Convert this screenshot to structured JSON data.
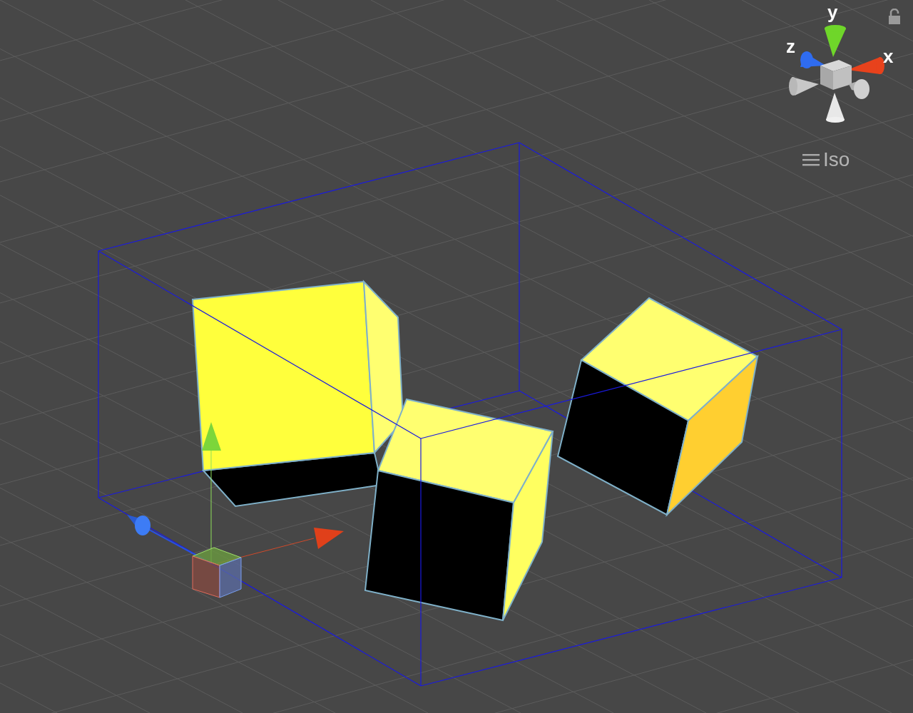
{
  "scene_gizmo": {
    "axes": [
      {
        "label": "y",
        "color": "#6fd62a"
      },
      {
        "label": "z",
        "color": "#2f6cf0"
      },
      {
        "label": "x",
        "color": "#e8421c"
      }
    ],
    "locked": false
  },
  "projection_button": {
    "label": "Iso"
  }
}
